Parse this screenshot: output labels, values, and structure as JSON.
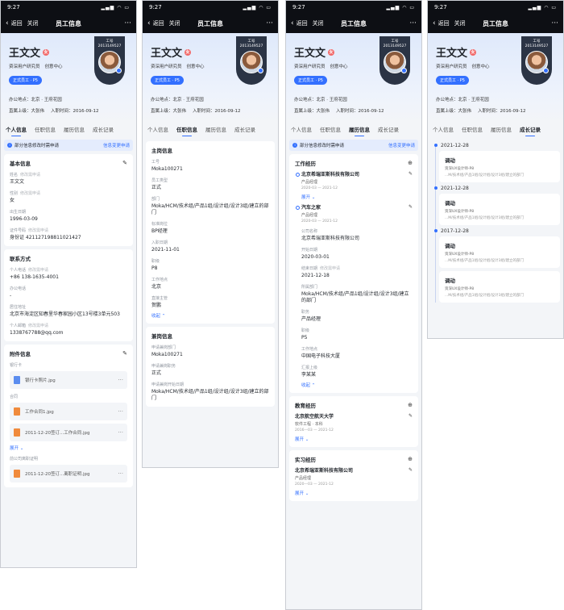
{
  "status": {
    "time": "9:27"
  },
  "nav": {
    "back": "返回",
    "close": "关闭",
    "title": "员工信息",
    "more": "···"
  },
  "profile": {
    "name": "王文文",
    "name_tag": "女",
    "position": "资深用户研究员",
    "department": "创意中心",
    "status_pill": "正式员工 · P5",
    "badge_label": "工号",
    "badge_id": "2013149527",
    "office": "办公地点：北京 · 王府花园",
    "manager": "直属上级：大张伟",
    "hire_date": "入职时间：2016-09-12"
  },
  "tabs": [
    "个人信息",
    "任职信息",
    "履历信息",
    "成长记录"
  ],
  "notice": {
    "text": "部分信息修改时需申请",
    "link": "信息变更申请"
  },
  "personal": {
    "basic": {
      "title": "基本信息",
      "fields": [
        {
          "label": "姓名",
          "hint": "修改需申请",
          "value": "王文文"
        },
        {
          "label": "性别",
          "hint": "修改需申请",
          "value": "女"
        },
        {
          "label": "出生日期",
          "hint": "",
          "value": "1996-03-09"
        },
        {
          "label": "证件号码",
          "hint": "修改需申请",
          "value": "身份证 421127198811021427"
        }
      ]
    },
    "contact": {
      "title": "联系方式",
      "fields": [
        {
          "label": "个人电话",
          "hint": "修改需申请",
          "value": "+86 138-1635-4001"
        },
        {
          "label": "办公电话",
          "hint": "",
          "value": "-"
        },
        {
          "label": "居住地址",
          "hint": "",
          "value": "北京市海淀区知春里华春家园小区13号楼3单元503"
        },
        {
          "label": "个人邮箱",
          "hint": "修改需申请",
          "value": "1338767788@qq.com"
        }
      ]
    },
    "attachments": {
      "title": "附件信息",
      "groups": [
        {
          "label": "银行卡",
          "files": [
            "银行卡照片.jpg"
          ]
        },
        {
          "label": "合同",
          "files": [
            "工作合同1.jpg",
            "2011-12-20签订...工作合同.jpg"
          ]
        },
        {
          "label": "前公司离职证明",
          "files": [
            "2011-12-20签订...离职证明.jpg"
          ]
        }
      ],
      "expand": "展开"
    }
  },
  "job": {
    "main": {
      "title": "主岗信息",
      "fields": [
        {
          "label": "工号",
          "value": "Moka100271"
        },
        {
          "label": "员工类型",
          "value": "正式"
        },
        {
          "label": "部门",
          "value": "Moka/HCM/技术组/产品1组/设计组/设计3组/建立的部门"
        },
        {
          "label": "标准岗位",
          "value": "BP经理"
        },
        {
          "label": "入职日期",
          "value": "2021-11-01"
        },
        {
          "label": "职级",
          "value": "P8"
        },
        {
          "label": "工作地点",
          "value": "北京"
        },
        {
          "label": "直接主管",
          "value": "贺鹏"
        }
      ],
      "collapse": "收起"
    },
    "side": {
      "title": "兼岗信息",
      "fields": [
        {
          "label": "申请兼岗部门",
          "value": "Moka100271"
        },
        {
          "label": "申请兼岗职务",
          "value": "正式"
        },
        {
          "label": "申请兼岗开始日期",
          "value": "Moka/HCM/技术组/产品1组/设计组/设计3组/建立的部门"
        }
      ]
    }
  },
  "resume": {
    "work": {
      "title": "工作经历",
      "items": [
        {
          "company": "北京希瑞亚斯科技有限公司",
          "role": "产品经理",
          "dates": "2020-03 — 2021-12"
        },
        {
          "company": "汽车之家",
          "role": "产品经理",
          "dates": "2020-03 — 2021-12"
        }
      ],
      "expand1": "展开",
      "fields": [
        {
          "label": "公司名称",
          "hint": "",
          "value": "北京希瑞亚斯科技有限公司"
        },
        {
          "label": "开始日期",
          "hint": "",
          "value": "2020-03-01"
        },
        {
          "label": "结束日期",
          "hint": "修改需申请",
          "value": "2021-12-18"
        },
        {
          "label": "所属部门",
          "hint": "",
          "value": "Moka/HCM/技术组/产品1组/设计组/设计3组/建立的部门"
        },
        {
          "label": "职务",
          "hint": "",
          "value": "产品经理"
        },
        {
          "label": "职级",
          "hint": "",
          "value": "P5"
        },
        {
          "label": "工作地点",
          "hint": "",
          "value": "中国电子科技大厦"
        },
        {
          "label": "汇报上级",
          "hint": "",
          "value": "李某某"
        }
      ],
      "collapse": "收起"
    },
    "edu": {
      "title": "教育经历",
      "school": "北京航空航天大学",
      "major": "软件工程 · 本科",
      "dates": "2016—03 — 2021-12",
      "expand": "展开"
    },
    "intern": {
      "title": "实习经历",
      "company": "北京希瑞亚斯科技有限公司",
      "role": "产品经理",
      "dates": "2020—03 — 2021-12",
      "expand": "展开"
    }
  },
  "growth": {
    "entries": [
      {
        "date": "2021-12-28",
        "cards": [
          {
            "title": "调动",
            "l1": "资深UX设计师-P8",
            "l2": "...M/技术组/产品1组/设计组/设计3组/建立的部门"
          }
        ]
      },
      {
        "date": "2021-12-28",
        "cards": [
          {
            "title": "调动",
            "l1": "资深UX设计师-P8",
            "l2": "...M/技术组/产品1组/设计组/设计3组/建立的部门"
          }
        ]
      },
      {
        "date": "2017-12-28",
        "cards": [
          {
            "title": "调动",
            "l1": "资深UX设计师-P8",
            "l2": "...M/技术组/产品1组/设计组/设计3组/建立的部门"
          },
          {
            "title": "调动",
            "l1": "资深UX设计师-P8",
            "l2": "...M/技术组/产品1组/设计组/设计3组/建立的部门"
          }
        ]
      }
    ]
  },
  "colors": {
    "accent": "#3370ff",
    "nav_bg": "#0d0f14",
    "page_bg": "#f3f5f8"
  }
}
